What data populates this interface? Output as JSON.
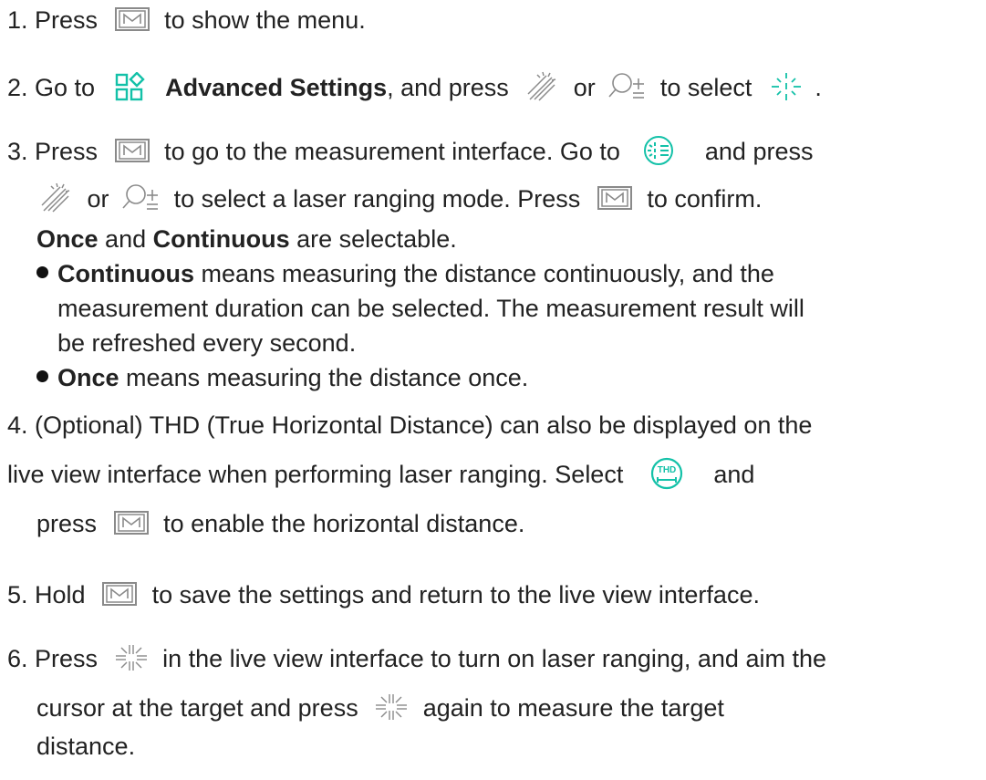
{
  "colors": {
    "text": "#222222",
    "icon_gray": "#8a8a8a",
    "accent_teal": "#13c1a8"
  },
  "icons": {
    "menu_button": "m-button-icon",
    "advanced_settings": "advanced-settings-icon",
    "brightness_up": "brightness-icon",
    "zoom": "zoom-icon",
    "laser_ranging": "laser-ranging-icon",
    "laser_mode": "laser-mode-icon",
    "thd": "thd-icon",
    "laser_button": "laser-button-icon"
  },
  "steps": {
    "s1": {
      "a": "1. Press",
      "b": "to show the menu."
    },
    "s2": {
      "a": "2. Go to",
      "b": "Advanced Settings",
      "c": ", and press",
      "d": "or",
      "e": "to select",
      "f": "."
    },
    "s3": {
      "a": "3. Press",
      "b": "to go to the measurement interface. Go to",
      "c": "and press",
      "d": "or",
      "e": "to select a laser ranging mode. Press",
      "f": "to confirm.",
      "g": "Once",
      "h": "and",
      "i": "Continuous",
      "j": "are selectable.",
      "bullet1": {
        "bold": "Continuous",
        "l1": "means measuring the distance continuously, and the",
        "l2": "measurement duration can be selected. The measurement result will",
        "l3": "be refreshed every second."
      },
      "bullet2": {
        "bold": "Once",
        "text": "means measuring the distance once."
      }
    },
    "s4": {
      "l1": "4. (Optional) THD (True Horizontal Distance) can also be displayed on the",
      "l2": "live view interface when performing laser ranging. Select",
      "l2b": "and",
      "l3a": "press",
      "l3b": "to enable the horizontal distance."
    },
    "s5": {
      "a": "5. Hold",
      "b": "to save the settings and return to the live view interface."
    },
    "s6": {
      "a": "6. Press",
      "b": "in the live view interface to turn on laser ranging, and aim the",
      "c": "cursor at the target and press",
      "d": "again to measure the target",
      "e": "distance."
    }
  }
}
